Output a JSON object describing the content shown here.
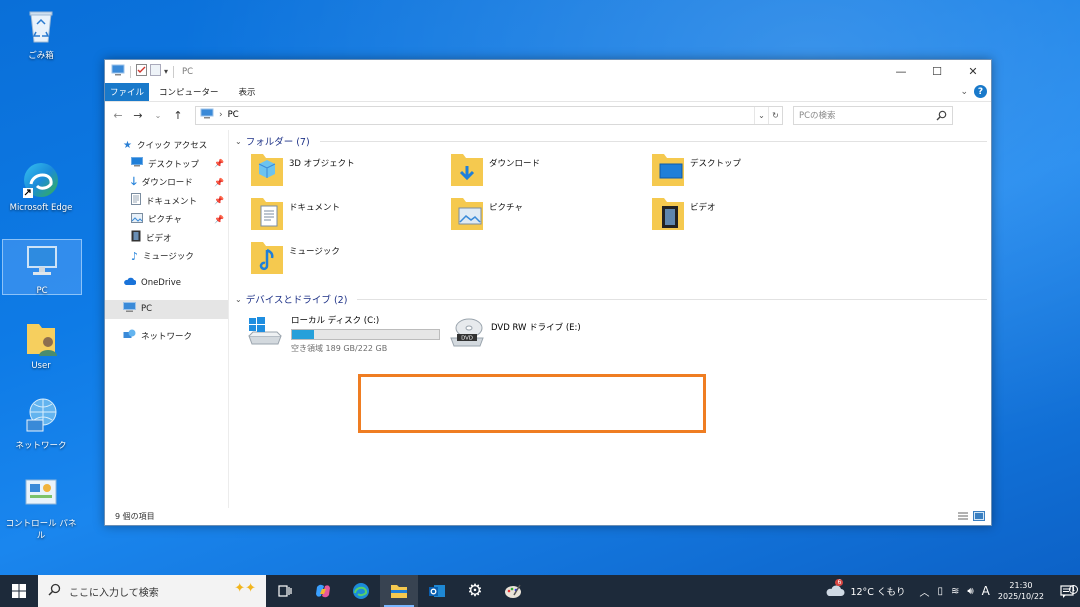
{
  "desktop": {
    "icons": [
      {
        "label": "ごみ箱",
        "icon": "recycle-bin-icon"
      },
      {
        "label": "Microsoft Edge",
        "icon": "edge-icon"
      },
      {
        "label": "PC",
        "icon": "pc-icon"
      },
      {
        "label": "User",
        "icon": "user-folder-icon"
      },
      {
        "label": "ネットワーク",
        "icon": "network-icon"
      },
      {
        "label": "コントロール パネル",
        "icon": "control-panel-icon"
      }
    ]
  },
  "window": {
    "title": "PC",
    "ribbon_tabs": [
      "ファイル",
      "コンピューター",
      "表示"
    ],
    "address": "PC",
    "search_placeholder": "PCの検索",
    "nav": {
      "quick_access": "クイック アクセス",
      "quick_items": [
        "デスクトップ",
        "ダウンロード",
        "ドキュメント",
        "ピクチャ",
        "ビデオ",
        "ミュージック"
      ],
      "onedrive": "OneDrive",
      "pc": "PC",
      "network": "ネットワーク"
    },
    "folders_header": "フォルダー (7)",
    "folders": [
      "3D オブジェクト",
      "ダウンロード",
      "デスクトップ",
      "ドキュメント",
      "ピクチャ",
      "ビデオ",
      "ミュージック"
    ],
    "drives_header": "デバイスとドライブ (2)",
    "drives": [
      {
        "name": "ローカル ディスク (C:)",
        "free_text": "空き領域 189 GB/222 GB",
        "used_fraction": 0.15
      },
      {
        "name": "DVD RW ドライブ (E:)"
      }
    ],
    "status": "9 個の項目"
  },
  "taskbar": {
    "search_placeholder": "ここに入力して検索",
    "weather": "12°C くもり",
    "weather_badge": "6",
    "ime": "A",
    "time": "21:30",
    "date": "2025/10/22",
    "notification_count": "1"
  },
  "colors": {
    "accent": "#1979ca",
    "highlight_box": "#ef7d22",
    "drive_bar": "#26a0da",
    "taskbar": "#1d2a3a"
  }
}
